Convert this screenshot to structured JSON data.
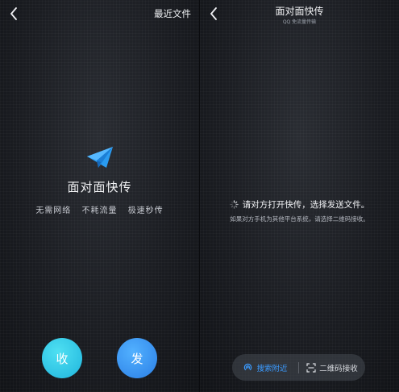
{
  "left_panel": {
    "back_icon": "chevron-left-icon",
    "recent_files_label": "最近文件",
    "logo_icon": "paper-plane-icon",
    "title": "面对面快传",
    "features": [
      "无需网络",
      "不耗流量",
      "极速秒传"
    ],
    "receive_label": "收",
    "send_label": "发"
  },
  "right_panel": {
    "back_icon": "chevron-left-icon",
    "title": "面对面快传",
    "subtitle": "QQ 免流量传输",
    "status_text": "请对方打开快传，选择发送文件。",
    "hint_text": "如果对方手机为其他平台系统，请选择二维码接收。",
    "search_nearby_label": "搜索附近",
    "qr_receive_label": "二维码接收"
  },
  "colors": {
    "receive_button": "#2cc6e6",
    "send_button": "#3a95f5",
    "accent_blue": "#3b9bff",
    "background": "#1b1d22"
  }
}
